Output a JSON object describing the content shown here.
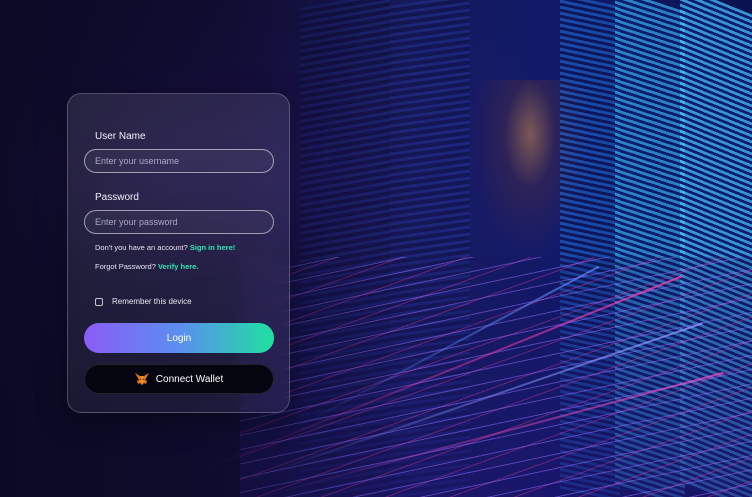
{
  "form": {
    "username": {
      "label": "User Name",
      "placeholder": "Enter your username",
      "value": ""
    },
    "password": {
      "label": "Password",
      "placeholder": "Enter your password",
      "value": ""
    },
    "signup": {
      "prompt": "Don't you have an account?",
      "link": "Sign in here!"
    },
    "forgot": {
      "prompt": "Forgot Password?",
      "link": "Verify here."
    },
    "remember": {
      "label": "Remember this device",
      "checked": false
    },
    "login_label": "Login",
    "wallet": {
      "label": "Connect Wallet",
      "icon": "metamask-fox-icon"
    }
  },
  "colors": {
    "accent_purple": "#8a5cf6",
    "accent_teal": "#1fe0a0",
    "link": "#2ee6b6",
    "background": "#0b0a24"
  }
}
